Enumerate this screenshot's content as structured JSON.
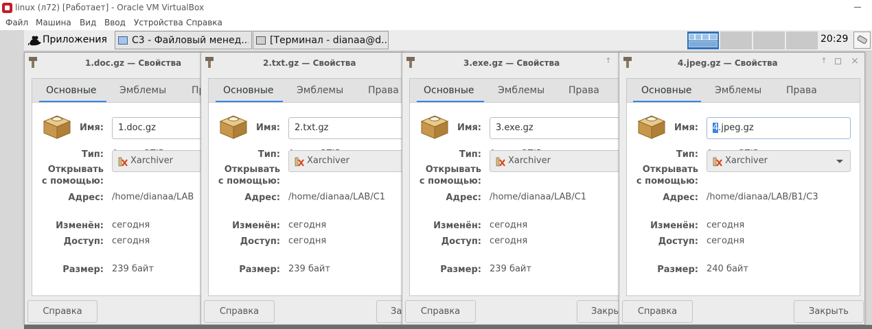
{
  "vbox": {
    "title": "linux (л72) [Работает] - Oracle VM VirtualBox",
    "menu": [
      "Файл",
      "Машина",
      "Вид",
      "Ввод",
      "Устройства",
      "Справка"
    ]
  },
  "panel": {
    "apps_label": "Приложения",
    "tasks": [
      "C3 - Файловый менед...",
      "[Терминал - dianaa@d..."
    ],
    "clock": "20:29"
  },
  "labels": {
    "name": "Имя:",
    "type": "Тип:",
    "open_with": "Открывать\nс помощью:",
    "address": "Адрес:",
    "modified": "Изменён:",
    "accessed": "Доступ:",
    "size": "Размер:"
  },
  "tabs": [
    "Основные",
    "Эмблемы",
    "Права"
  ],
  "buttons": {
    "help": "Справка",
    "close": "Закрыть"
  },
  "dialogs": [
    {
      "title": "1.doc.gz — Свойства",
      "name": "1.doc.gz",
      "type": "Архив GZIP",
      "app": "Xarchiver",
      "address": "/home/dianaa/LAB",
      "modified": "сегодня",
      "accessed": "сегодня",
      "size": "239 байт"
    },
    {
      "title": "2.txt.gz — Свойства",
      "name": "2.txt.gz",
      "type": "Архив GZIP",
      "app": "Xarchiver",
      "address": "/home/dianaa/LAB/C1",
      "modified": "сегодня",
      "accessed": "сегодня",
      "size": "239 байт"
    },
    {
      "title": "3.exe.gz — Свойства",
      "name": "3.exe.gz",
      "type": "Архив GZIP",
      "app": "Xarchiver",
      "address": "/home/dianaa/LAB/C1",
      "modified": "сегодня",
      "accessed": "сегодня",
      "size": "239 байт"
    },
    {
      "title": "4.jpeg.gz — Свойства",
      "name_selected": "4",
      "name_rest": ".jpeg.gz",
      "type": "Архив GZIP",
      "app": "Xarchiver",
      "address": "/home/dianaa/LAB/B1/C3",
      "modified": "сегодня",
      "accessed": "сегодня",
      "size": "240 байт"
    }
  ],
  "colors": {
    "accent": "#3584e4",
    "workspace_active": "#2f72b6",
    "vbox_logo": "#c01c28"
  }
}
